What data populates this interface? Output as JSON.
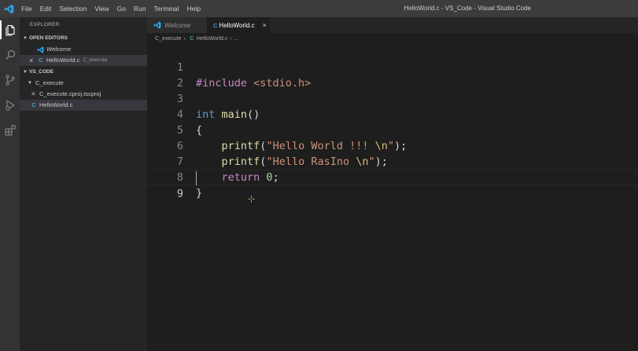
{
  "window": {
    "title": "HelloWorld.c - VS_Code - Visual Studio Code"
  },
  "menu": [
    "File",
    "Edit",
    "Selection",
    "View",
    "Go",
    "Run",
    "Terminal",
    "Help"
  ],
  "activity_icons": [
    "files-icon",
    "search-icon",
    "source-control-icon",
    "run-debug-icon",
    "extensions-icon"
  ],
  "sidebar": {
    "title": "EXPLORER",
    "open_editors": {
      "header": "OPEN EDITORS",
      "items": [
        {
          "label": "Welcome",
          "description": ""
        },
        {
          "label": "HelloWorld.c",
          "description": "C_execute"
        }
      ]
    },
    "workspace": {
      "header": "VS_CODE",
      "folder": "C_execute",
      "files": [
        "C_execute.cproj.tscproj",
        "HelloWorld.c"
      ]
    }
  },
  "tabs": [
    {
      "label": "Welcome",
      "active": false
    },
    {
      "label": "HelloWorld.c",
      "active": true
    }
  ],
  "breadcrumb": {
    "folder": "C_execute",
    "file": "HelloWorld.c",
    "symbol": "..."
  },
  "editor": {
    "cursor_line": 9,
    "line_numbers": [
      "1",
      "2",
      "3",
      "4",
      "5",
      "6",
      "7",
      "8",
      "9"
    ],
    "lines": {
      "l1": {
        "directive": "#include",
        "header": " <stdio.h>"
      },
      "l3": {
        "type": "int",
        "name": " main",
        "paren": "()"
      },
      "l4": {
        "brace": "{"
      },
      "l5": {
        "indent": "    ",
        "fn": "printf",
        "open": "(",
        "str": "\"Hello World !!! ",
        "esc": "\\n",
        "str_end": "\"",
        "close": ");"
      },
      "l6": {
        "indent": "    ",
        "fn": "printf",
        "open": "(",
        "str": "\"Hello RasIno ",
        "esc": "\\n",
        "str_end": "\"",
        "close": ");"
      },
      "l7": {
        "indent": "    ",
        "kw": "return",
        "num": " 0",
        "semi": ";"
      },
      "l8": {
        "brace": "}"
      }
    }
  },
  "colors": {
    "accent": "#007acc",
    "c_file_icon": "#519aba",
    "editor_bg": "#1e1e1e",
    "sidebar_bg": "#252526"
  }
}
